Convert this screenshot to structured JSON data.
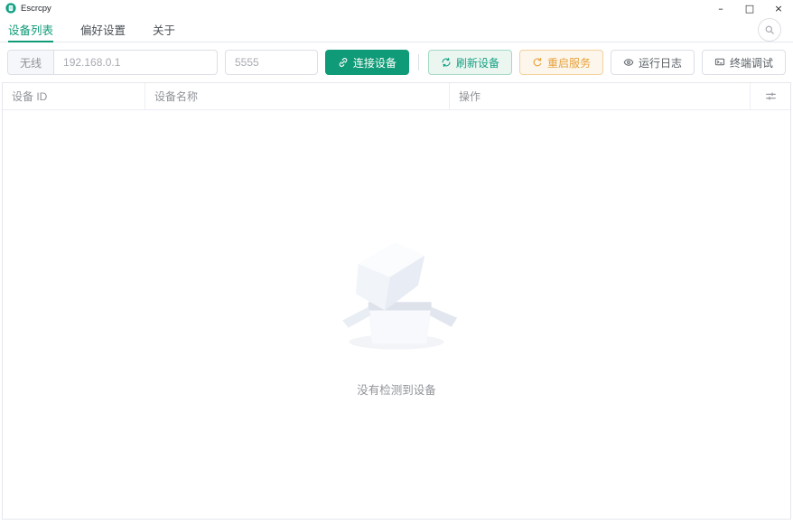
{
  "window": {
    "title": "Escrcpy",
    "minimize_glyph": "–",
    "maximize_glyph": "□",
    "close_glyph": "×"
  },
  "tabs": [
    {
      "label": "设备列表",
      "active": true
    },
    {
      "label": "偏好设置",
      "active": false
    },
    {
      "label": "关于",
      "active": false
    }
  ],
  "toolbar": {
    "connection_mode": "无线",
    "host_value": "",
    "host_placeholder": "192.168.0.1",
    "port_value": "",
    "port_placeholder": "5555",
    "connect_label": "连接设备",
    "refresh_label": "刷新设备",
    "restart_label": "重启服务",
    "logs_label": "运行日志",
    "terminal_label": "终端调试"
  },
  "table": {
    "columns": {
      "id": "设备 ID",
      "name": "设备名称",
      "actions": "操作"
    },
    "rows": [],
    "empty_text": "没有检测到设备"
  },
  "icons": {
    "app_logo": "escrcpy-logo",
    "search": "magnifier",
    "connect": "link",
    "refresh": "refresh-arrows",
    "restart": "refresh-right",
    "logs": "eye",
    "terminal": "monitor",
    "column_settings": "sliders",
    "empty_state": "open-box"
  },
  "colors": {
    "primary": "#0f9b77",
    "success_plain_bg": "#ebf6f1",
    "success_plain_border": "#a4d9c6",
    "warning_text": "#e6a23c",
    "warning_plain_bg": "#fdf6ec",
    "border": "#dcdfe6",
    "table_border": "#ebeef5",
    "muted_text": "#909399"
  }
}
